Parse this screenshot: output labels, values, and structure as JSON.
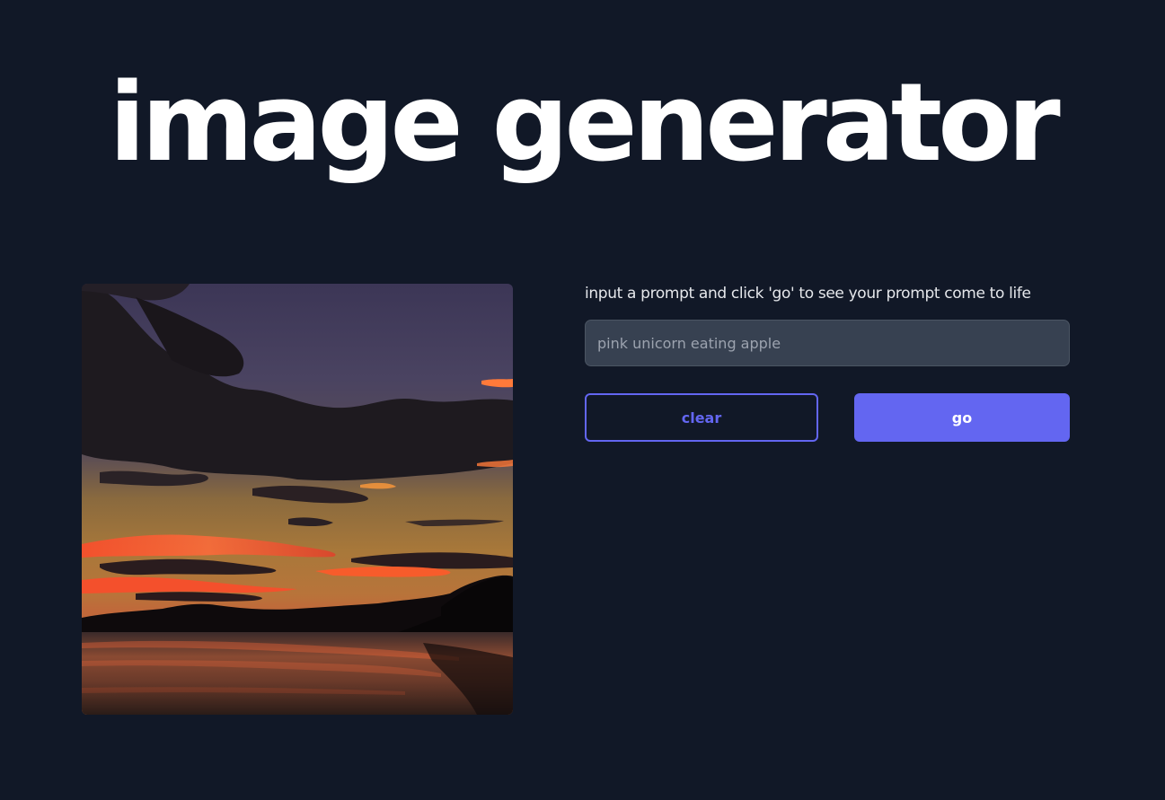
{
  "header": {
    "title": "image generator"
  },
  "generated_image": {
    "description_icon": "sunset-landscape-image"
  },
  "form": {
    "instructions": "input a prompt and click 'go' to see your prompt come to life",
    "prompt_value": "",
    "prompt_placeholder": "pink unicorn eating apple",
    "clear_label": "clear",
    "go_label": "go"
  },
  "colors": {
    "background": "#111827",
    "accent": "#6366f1",
    "input_bg": "#374151",
    "text": "#ffffff"
  }
}
